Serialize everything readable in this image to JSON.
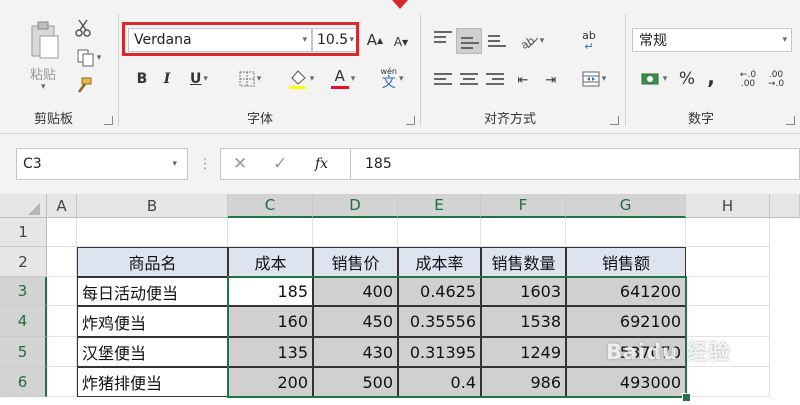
{
  "ribbon": {
    "clipboard": {
      "paste_label": "粘贴",
      "group_label": "剪贴板"
    },
    "font": {
      "font_name": "Verdana",
      "font_size": "10.5",
      "bold": "B",
      "italic": "I",
      "underline": "U",
      "font_color_glyph": "A",
      "phonetic_top": "wén",
      "phonetic_bottom": "文",
      "grow_font": "A",
      "shrink_font": "A",
      "group_label": "字体"
    },
    "alignment": {
      "wrap_glyph": "ab",
      "group_label": "对齐方式"
    },
    "number": {
      "format_value": "常规",
      "percent": "%",
      "comma": ",",
      "inc_decimal_top": "←.0",
      "inc_decimal_bottom": ".00",
      "dec_decimal_top": ".00",
      "dec_decimal_bottom": "→.0",
      "group_label": "数字"
    },
    "highlight_color": "#d9272e"
  },
  "formula_bar": {
    "name_box": "C3",
    "fx": "fx",
    "content": "185"
  },
  "sheet": {
    "columns": [
      "A",
      "B",
      "C",
      "D",
      "E",
      "F",
      "G",
      "H"
    ],
    "rows": [
      "1",
      "2",
      "3",
      "4",
      "5",
      "6"
    ],
    "headers": [
      "商品名",
      "成本",
      "销售价",
      "成本率",
      "销售数量",
      "销售额"
    ],
    "data": [
      [
        "每日活动便当",
        "185",
        "400",
        "0.4625",
        "1603",
        "641200"
      ],
      [
        "炸鸡便当",
        "160",
        "450",
        "0.35556",
        "1538",
        "692100"
      ],
      [
        "汉堡便当",
        "135",
        "430",
        "0.31395",
        "1249",
        "537070"
      ],
      [
        "炸猪排便当",
        "200",
        "500",
        "0.4",
        "986",
        "493000"
      ]
    ],
    "header_fill": "#dde4f0",
    "selection_fill": "#d0d0d0",
    "selection_border": "#217346"
  },
  "watermark": "Baidu 经验"
}
